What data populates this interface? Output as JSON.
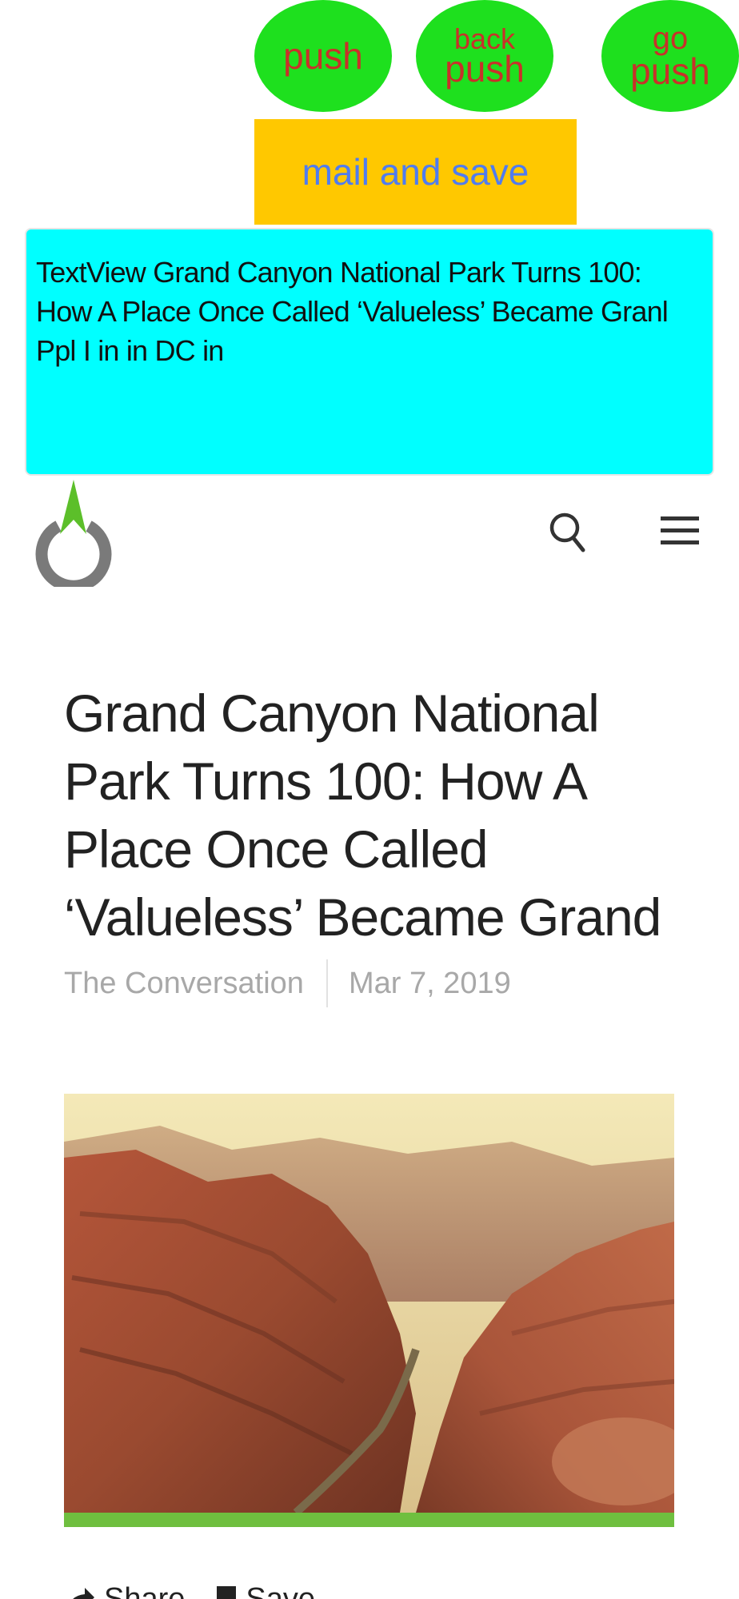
{
  "toolbar": {
    "push_label": "push",
    "back_push_top": "back",
    "back_push_bottom": "push",
    "go_push_top": "go",
    "go_push_bottom": "push",
    "mail_save_label": "mail and save"
  },
  "textview": {
    "line1": "TextView Grand Canyon National Park Turns 100:",
    "line2": "How A Place Once Called ‘Valueless’ Became Granl",
    "line3": "Ppl I in in   DC in"
  },
  "header": {
    "logo_icon": "power-arrow-logo",
    "search_icon": "search-icon",
    "menu_icon": "hamburger-menu-icon"
  },
  "article": {
    "title_lines": [
      "Grand Canyon National",
      "Park Turns 100: How A",
      "Place Once Called",
      "‘Valueless’ Became Grand"
    ],
    "source": "The Conversation",
    "date": "Mar 7, 2019",
    "share_label": "Share",
    "save_label": "Save"
  },
  "colors": {
    "oval_button": "#1ee01e",
    "oval_text": "#c8312a",
    "mail_button": "#ffc800",
    "mail_text": "#4f7cf0",
    "textview_bg": "#00ffff",
    "accent_green": "#6fbf3f"
  }
}
